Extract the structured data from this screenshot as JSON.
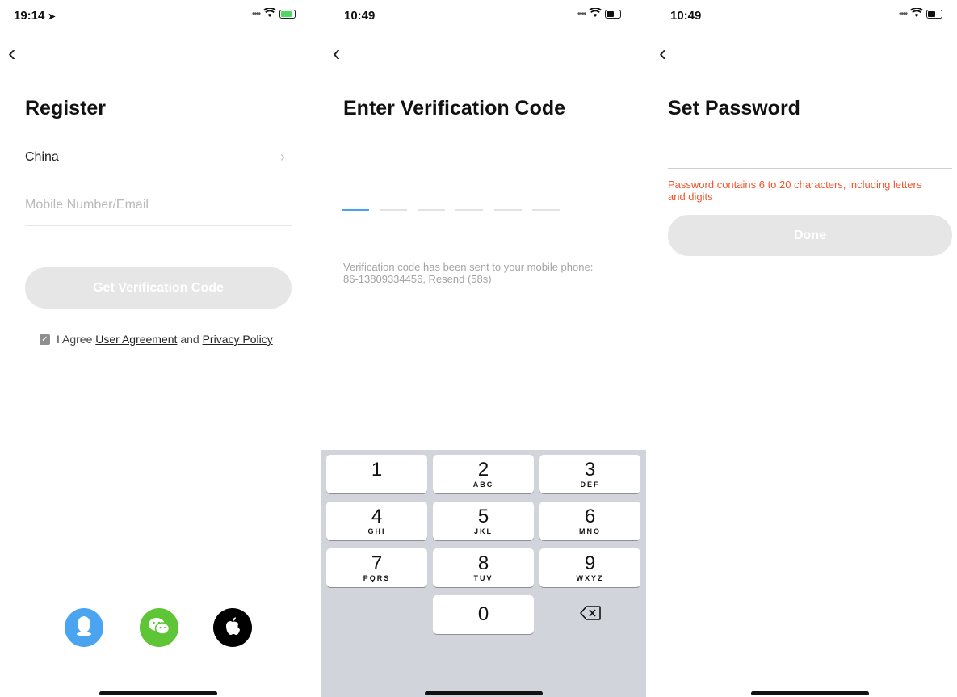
{
  "screens": {
    "register": {
      "status_time": "19:14",
      "title": "Register",
      "country": "China",
      "account_placeholder": "Mobile Number/Email",
      "submit_label": "Get Verification Code",
      "agree_prefix": "I Agree",
      "user_agreement": "User Agreement",
      "and": "and",
      "privacy_policy": "Privacy Policy",
      "social": [
        "qq-icon",
        "wechat-icon",
        "apple-icon"
      ]
    },
    "verify": {
      "status_time": "10:49",
      "title": "Enter Verification Code",
      "code_length": 6,
      "hint": "Verification code has been sent to your mobile phone: 86-13809334456, Resend (58s)",
      "keys": [
        {
          "num": "1",
          "sub": ""
        },
        {
          "num": "2",
          "sub": "ABC"
        },
        {
          "num": "3",
          "sub": "DEF"
        },
        {
          "num": "4",
          "sub": "GHI"
        },
        {
          "num": "5",
          "sub": "JKL"
        },
        {
          "num": "6",
          "sub": "MNO"
        },
        {
          "num": "7",
          "sub": "PQRS"
        },
        {
          "num": "8",
          "sub": "TUV"
        },
        {
          "num": "9",
          "sub": "WXYZ"
        },
        {
          "num": "0",
          "sub": ""
        }
      ]
    },
    "password": {
      "status_time": "10:49",
      "title": "Set Password",
      "error": "Password contains 6 to 20 characters, including letters and digits",
      "done_label": "Done"
    }
  },
  "colors": {
    "disabled_button": "#e6e6e6",
    "active_dash": "#4aa3f0",
    "error_text": "#f0552c",
    "qq": "#4aa4f0",
    "wechat": "#5dc536",
    "apple": "#000000"
  }
}
